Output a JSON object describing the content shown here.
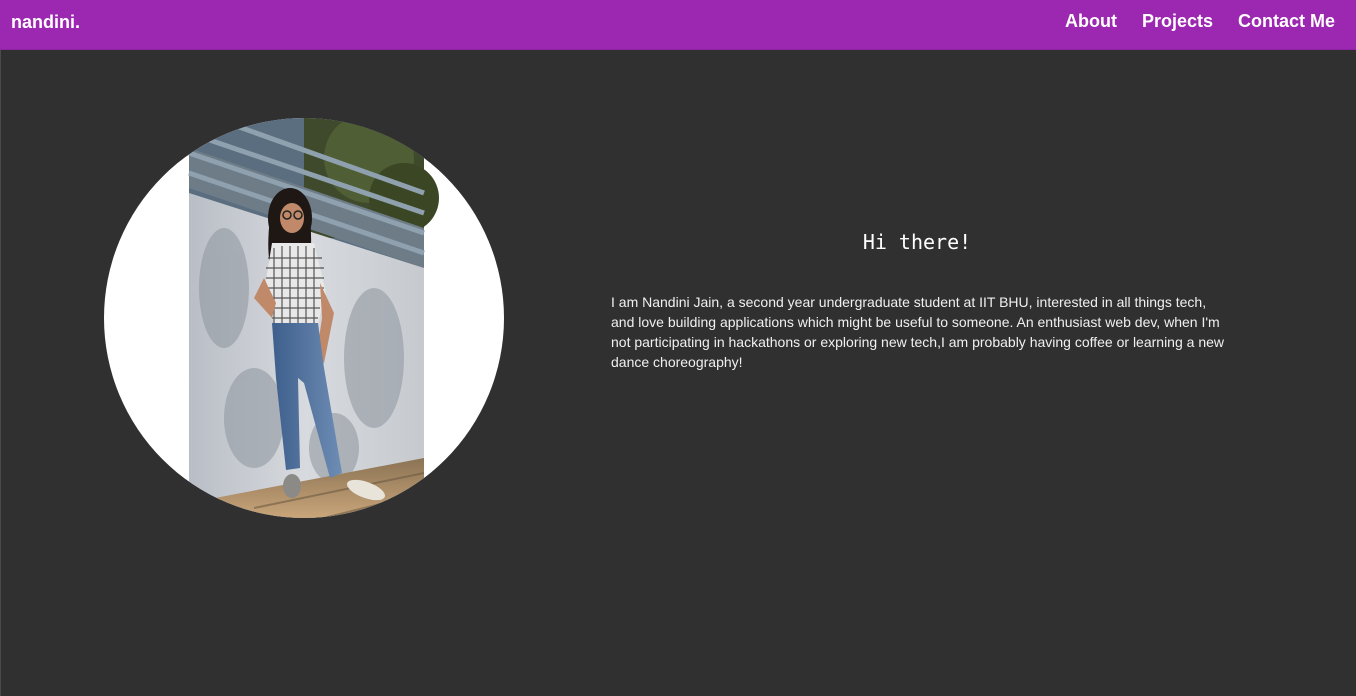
{
  "navbar": {
    "brand": "nandini.",
    "links": [
      {
        "label": "About"
      },
      {
        "label": "Projects"
      },
      {
        "label": "Contact Me"
      }
    ],
    "background_color": "#9c27b0"
  },
  "hero": {
    "photo_alt": "profile photo",
    "greeting": "Hi there!",
    "bio": "I am Nandini Jain, a second year undergraduate student at IIT BHU, interested in all things tech, and love building applications which might be useful to someone. An enthusiast web dev, when I'm not participating in hackathons or exploring new tech,I am probably having coffee or learning a new dance choreography!"
  },
  "page": {
    "background_color": "#303030"
  }
}
